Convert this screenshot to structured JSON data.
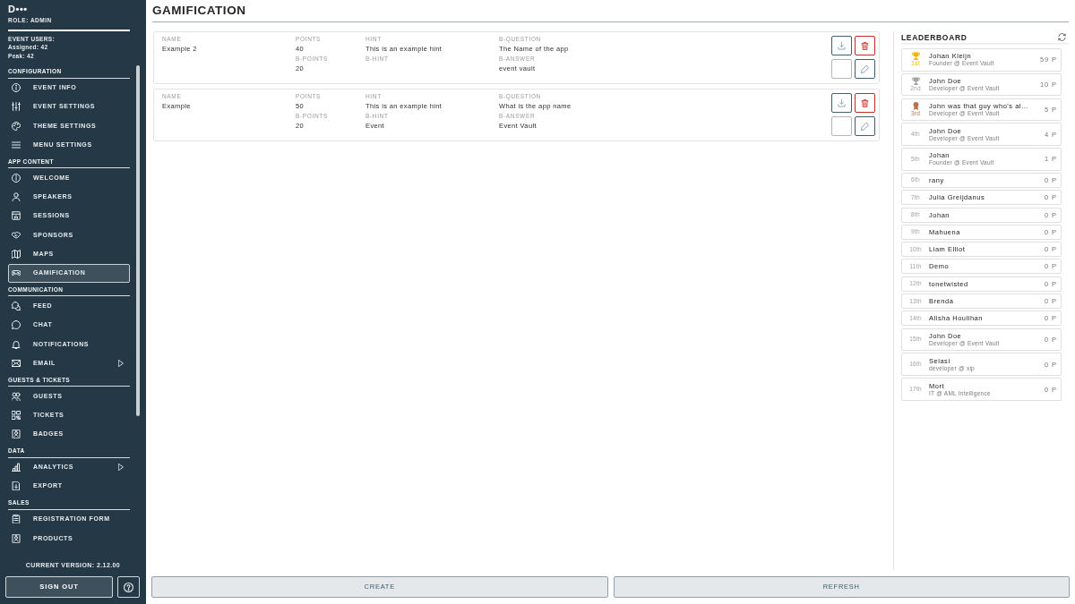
{
  "sidebar": {
    "account_name": "D•••",
    "role": "ROLE: ADMIN",
    "event_users": {
      "title": "EVENT USERS:",
      "assigned": "Assigned: 42",
      "peak": "Peak: 42"
    },
    "sections": [
      {
        "title": "CONFIGURATION",
        "items": [
          {
            "label": "EVENT INFO",
            "selected": false,
            "expandable": false
          },
          {
            "label": "EVENT SETTINGS",
            "selected": false,
            "expandable": false
          },
          {
            "label": "THEME SETTINGS",
            "selected": false,
            "expandable": false
          },
          {
            "label": "MENU SETTINGS",
            "selected": false,
            "expandable": false
          }
        ]
      },
      {
        "title": "APP CONTENT",
        "items": [
          {
            "label": "WELCOME",
            "selected": false,
            "expandable": false
          },
          {
            "label": "SPEAKERS",
            "selected": false,
            "expandable": false
          },
          {
            "label": "SESSIONS",
            "selected": false,
            "expandable": false
          },
          {
            "label": "SPONSORS",
            "selected": false,
            "expandable": false
          },
          {
            "label": "MAPS",
            "selected": false,
            "expandable": false
          },
          {
            "label": "GAMIFICATION",
            "selected": true,
            "expandable": false
          }
        ]
      },
      {
        "title": "COMMUNICATION",
        "items": [
          {
            "label": "FEED",
            "selected": false,
            "expandable": false
          },
          {
            "label": "CHAT",
            "selected": false,
            "expandable": false
          },
          {
            "label": "NOTIFICATIONS",
            "selected": false,
            "expandable": false
          },
          {
            "label": "EMAIL",
            "selected": false,
            "expandable": true
          }
        ]
      },
      {
        "title": "GUESTS & TICKETS",
        "items": [
          {
            "label": "GUESTS",
            "selected": false,
            "expandable": false
          },
          {
            "label": "TICKETS",
            "selected": false,
            "expandable": false
          },
          {
            "label": "BADGES",
            "selected": false,
            "expandable": false
          }
        ]
      },
      {
        "title": "DATA",
        "items": [
          {
            "label": "ANALYTICS",
            "selected": false,
            "expandable": true
          },
          {
            "label": "EXPORT",
            "selected": false,
            "expandable": false
          }
        ]
      },
      {
        "title": "SALES",
        "items": [
          {
            "label": "REGISTRATION FORM",
            "selected": false,
            "expandable": false
          },
          {
            "label": "PRODUCTS",
            "selected": false,
            "expandable": false
          }
        ]
      }
    ],
    "version": "CURRENT VERSION: 2.12.00",
    "sign_out_button": "SIGN OUT"
  },
  "page_title": "GAMIFICATION",
  "challenges": [
    {
      "columns": [
        {
          "fields": [
            {
              "label": "NAME",
              "value": "Example 2"
            }
          ]
        },
        {
          "fields": [
            {
              "label": "POINTS",
              "value": "40"
            },
            {
              "label": "B-POINTS",
              "value": "20"
            }
          ]
        },
        {
          "fields": [
            {
              "label": "HINT",
              "value": "This is an example hint"
            },
            {
              "label": "B-HINT"
            }
          ]
        },
        {
          "fields": [
            {
              "label": "B-QUESTION",
              "value": "The Name of the app"
            },
            {
              "label": "B-ANSWER",
              "value": "event vault"
            }
          ]
        }
      ]
    },
    {
      "columns": [
        {
          "fields": [
            {
              "label": "NAME",
              "value": "Example"
            }
          ]
        },
        {
          "fields": [
            {
              "label": "POINTS",
              "value": "50"
            },
            {
              "label": "B-POINTS",
              "value": "20"
            }
          ]
        },
        {
          "fields": [
            {
              "label": "HINT",
              "value": "This is an example hint"
            },
            {
              "label": "B-HINT",
              "value": "Event"
            }
          ]
        },
        {
          "fields": [
            {
              "label": "B-QUESTION",
              "value": "What is the app name"
            },
            {
              "label": "B-ANSWER",
              "value": "Event Vault"
            }
          ]
        }
      ]
    }
  ],
  "leaderboard": {
    "title": "LEADERBOARD",
    "entries": [
      {
        "rank": "1st",
        "kind": "trophy",
        "color": "#f2b400",
        "name": "Johan Kleijn",
        "subtitle": "Founder @ Event Vault",
        "points": "59 P"
      },
      {
        "rank": "2nd",
        "kind": "trophy",
        "color": "#a3a3a3",
        "name": "John Doe",
        "subtitle": "Developer @ Event Vault",
        "points": "10 P"
      },
      {
        "rank": "3rd",
        "kind": "medal",
        "color": "#b8734e",
        "name": "John was that guy who's al…",
        "subtitle": "Developer @ Event Vault",
        "points": "5 P"
      },
      {
        "rank": "4th",
        "kind": "plain",
        "name": "John Doe",
        "subtitle": "Developer @ Event Vault",
        "points": "4 P"
      },
      {
        "rank": "5th",
        "kind": "plain",
        "name": "Johan",
        "subtitle": "Founder @ Event Vault",
        "points": "1 P"
      },
      {
        "rank": "6th",
        "kind": "plain",
        "name": "rany",
        "points": "0 P"
      },
      {
        "rank": "7th",
        "kind": "plain",
        "name": "Julia Greijdanus",
        "points": "0 P"
      },
      {
        "rank": "8th",
        "kind": "plain",
        "name": "Johan",
        "points": "0 P"
      },
      {
        "rank": "9th",
        "kind": "plain",
        "name": "Mahuena",
        "points": "0 P"
      },
      {
        "rank": "10th",
        "kind": "plain",
        "name": "Liam Elliot",
        "points": "0 P"
      },
      {
        "rank": "11th",
        "kind": "plain",
        "name": "Demo",
        "points": "0 P"
      },
      {
        "rank": "12th",
        "kind": "plain",
        "name": "tonetwisted",
        "points": "0 P"
      },
      {
        "rank": "13th",
        "kind": "plain",
        "name": "Brenda",
        "points": "0 P"
      },
      {
        "rank": "14th",
        "kind": "plain",
        "name": "Alisha Houlihan",
        "points": "0 P"
      },
      {
        "rank": "15th",
        "kind": "plain",
        "name": "John Doe",
        "subtitle": "Developer @ Event Vault",
        "points": "0 P"
      },
      {
        "rank": "16th",
        "kind": "plain",
        "name": "Selasi",
        "subtitle": "developer @ xip",
        "points": "0 P"
      },
      {
        "rank": "17th",
        "kind": "plain",
        "name": "Mort",
        "subtitle": "IT @ AML Intelligence",
        "points": "0 P"
      }
    ]
  },
  "footer_buttons": [
    "CREATE",
    "REFRESH"
  ]
}
